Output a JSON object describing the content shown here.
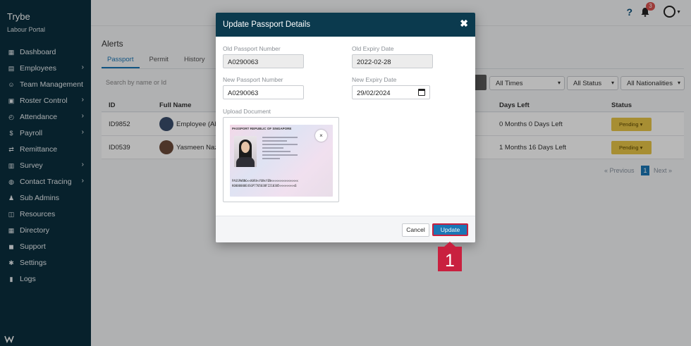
{
  "app": {
    "title": "Trybe",
    "subtitle": "Labour Portal"
  },
  "sidebar": {
    "items": [
      {
        "label": "Dashboard",
        "icon": "dashboard-icon",
        "glyph": "▦",
        "has_children": false
      },
      {
        "label": "Employees",
        "icon": "id-card-icon",
        "glyph": "▤",
        "has_children": true
      },
      {
        "label": "Team Management",
        "icon": "team-icon",
        "glyph": "☺",
        "has_children": false
      },
      {
        "label": "Roster Control",
        "icon": "calendar-icon",
        "glyph": "▣",
        "has_children": true
      },
      {
        "label": "Attendance",
        "icon": "clock-icon",
        "glyph": "◴",
        "has_children": true
      },
      {
        "label": "Payroll",
        "icon": "dollar-icon",
        "glyph": "$",
        "has_children": true
      },
      {
        "label": "Remittance",
        "icon": "exchange-icon",
        "glyph": "⇄",
        "has_children": false
      },
      {
        "label": "Survey",
        "icon": "poll-icon",
        "glyph": "▥",
        "has_children": true
      },
      {
        "label": "Contact Tracing",
        "icon": "contact-tracing-icon",
        "glyph": "◍",
        "has_children": true
      },
      {
        "label": "Sub Admins",
        "icon": "users-icon",
        "glyph": "♟",
        "has_children": false
      },
      {
        "label": "Resources",
        "icon": "box-icon",
        "glyph": "◫",
        "has_children": false
      },
      {
        "label": "Directory",
        "icon": "building-icon",
        "glyph": "▦",
        "has_children": false
      },
      {
        "label": "Support",
        "icon": "chat-icon",
        "glyph": "◼",
        "has_children": false
      },
      {
        "label": "Settings",
        "icon": "gear-icon",
        "glyph": "✱",
        "has_children": false
      },
      {
        "label": "Logs",
        "icon": "book-icon",
        "glyph": "▮",
        "has_children": false
      }
    ]
  },
  "header": {
    "help_glyph": "?",
    "notification_count": "3"
  },
  "main": {
    "title": "Alerts",
    "tabs": [
      {
        "label": "Passport",
        "active": true
      },
      {
        "label": "Permit",
        "active": false
      },
      {
        "label": "History",
        "active": false
      }
    ],
    "search_placeholder": "Search by name or Id",
    "filters": {
      "time": "All Times",
      "status": "All Status",
      "nationality": "All Nationalities"
    },
    "columns": {
      "id": "ID",
      "name": "Full Name",
      "days_left": "Days Left",
      "status": "Status"
    },
    "rows": [
      {
        "id": "ID9852",
        "name": "Employee (Abs",
        "days_left": "0 Months 0 Days Left",
        "status": "Pending"
      },
      {
        "id": "ID0539",
        "name": "Yasmeen Nazr",
        "days_left": "1 Months 16 Days Left",
        "status": "Pending"
      }
    ],
    "pagination": {
      "previous": "« Previous",
      "current": "1",
      "next": "Next »"
    }
  },
  "modal": {
    "title": "Update Passport Details",
    "close_glyph": "✖",
    "old_passport_label": "Old Passport Number",
    "old_passport_value": "A0290063",
    "old_expiry_label": "Old Expiry Date",
    "old_expiry_value": "2022-02-28",
    "new_passport_label": "New Passport Number",
    "new_passport_value": "A0290063",
    "new_expiry_label": "New Expiry Date",
    "new_expiry_value": "29/02/2024",
    "upload_label": "Upload Document",
    "passport_image": {
      "header_text": "PASSPORT   REPUBLIC OF SINGAPORE",
      "mrz_line1": "PASSPWONG<<KARA<YUN<YEN<<<<<<<<<<<<<<<<",
      "mrz_line2": "K0000000E4SGP7705038F2210305<<<<<<<<<6"
    },
    "remove_glyph": "×",
    "cancel_label": "Cancel",
    "update_label": "Update"
  },
  "callout": {
    "number": "1",
    "color": "#c9203f"
  }
}
